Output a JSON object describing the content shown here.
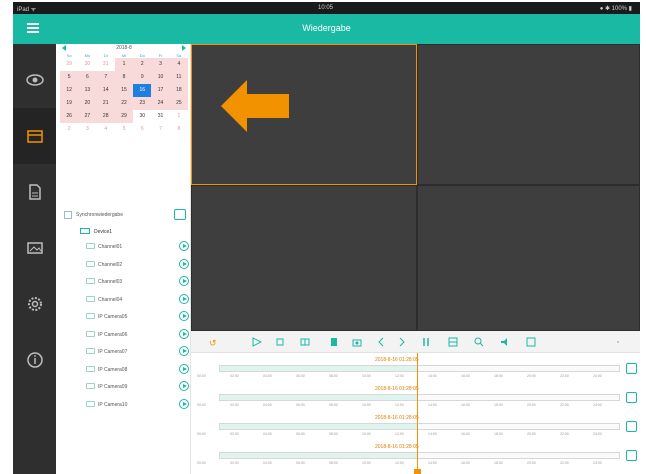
{
  "status_bar": {
    "left": "iPad ᯤ",
    "time": "10:05",
    "right": "● ✱ 100% ▮"
  },
  "header": {
    "title": "Wiedergabe"
  },
  "nav": [
    {
      "name": "live-view",
      "icon": "eye-icon",
      "active": false
    },
    {
      "name": "playback",
      "icon": "playback-icon",
      "active": true
    },
    {
      "name": "files",
      "icon": "file-icon",
      "active": false
    },
    {
      "name": "images",
      "icon": "image-icon",
      "active": false
    },
    {
      "name": "settings",
      "icon": "gear-icon",
      "active": false
    },
    {
      "name": "info",
      "icon": "info-icon",
      "active": false
    }
  ],
  "calendar": {
    "month_label": "2018-8",
    "weekdays": [
      "So",
      "Mo",
      "Di",
      "Mi",
      "Do",
      "Fr",
      "Sa"
    ],
    "days": [
      {
        "d": "29",
        "s": "other"
      },
      {
        "d": "30",
        "s": "other"
      },
      {
        "d": "31",
        "s": "other"
      },
      {
        "d": "1",
        "s": "rec"
      },
      {
        "d": "2",
        "s": "rec"
      },
      {
        "d": "3",
        "s": "rec"
      },
      {
        "d": "4",
        "s": "rec"
      },
      {
        "d": "5",
        "s": "rec"
      },
      {
        "d": "6",
        "s": "rec"
      },
      {
        "d": "7",
        "s": "rec"
      },
      {
        "d": "8",
        "s": "rec"
      },
      {
        "d": "9",
        "s": "rec"
      },
      {
        "d": "10",
        "s": "rec"
      },
      {
        "d": "11",
        "s": "rec"
      },
      {
        "d": "12",
        "s": "rec"
      },
      {
        "d": "13",
        "s": "rec"
      },
      {
        "d": "14",
        "s": "rec"
      },
      {
        "d": "15",
        "s": "rec"
      },
      {
        "d": "16",
        "s": "sel"
      },
      {
        "d": "17",
        "s": "rec"
      },
      {
        "d": "18",
        "s": "rec"
      },
      {
        "d": "19",
        "s": "rec"
      },
      {
        "d": "20",
        "s": "rec"
      },
      {
        "d": "21",
        "s": "rec"
      },
      {
        "d": "22",
        "s": "rec"
      },
      {
        "d": "23",
        "s": "rec"
      },
      {
        "d": "24",
        "s": "rec"
      },
      {
        "d": "25",
        "s": "rec"
      },
      {
        "d": "26",
        "s": "rec"
      },
      {
        "d": "27",
        "s": "rec"
      },
      {
        "d": "28",
        "s": "rec"
      },
      {
        "d": "29",
        "s": "rec"
      },
      {
        "d": "30",
        "s": ""
      },
      {
        "d": "31",
        "s": ""
      },
      {
        "d": "1",
        "s": "other"
      },
      {
        "d": "2",
        "s": "other"
      },
      {
        "d": "3",
        "s": "other"
      },
      {
        "d": "4",
        "s": "other"
      },
      {
        "d": "5",
        "s": "other"
      },
      {
        "d": "6",
        "s": "other"
      },
      {
        "d": "7",
        "s": "other"
      },
      {
        "d": "8",
        "s": "other"
      }
    ]
  },
  "sync": {
    "label": "Synchronwiedergabe"
  },
  "device": {
    "label": "Device1"
  },
  "channels": [
    "Channel01",
    "Channel02",
    "Channel03",
    "Channel04",
    "IP Camera05",
    "IP Camera06",
    "IP Camera07",
    "IP Camera08",
    "IP Camera09",
    "IP Camera10"
  ],
  "toolbar": [
    "rewind-icon",
    "play-icon",
    "stop-icon",
    "frame-icon",
    "clip-icon",
    "snapshot-icon",
    "slow-icon",
    "fast-icon",
    "pause-icon",
    "record-icon",
    "zoom-icon",
    "audio-icon",
    "fullscreen-icon",
    "more-icon"
  ],
  "timeline": {
    "tracks": [
      {
        "date": "2018-8-16 01:28:05"
      },
      {
        "date": "2018-8-16 01:28:05"
      },
      {
        "date": "2018-8-16 01:28:05"
      },
      {
        "date": "2018-8-16 01:28:05"
      }
    ],
    "ticks": [
      "00:00",
      "02:00",
      "04:00",
      "06:00",
      "08:00",
      "10:00",
      "12:00",
      "14:00",
      "16:00",
      "18:00",
      "20:00",
      "22:00",
      "24:00"
    ]
  },
  "colors": {
    "accent": "#1ab9a3",
    "selection": "#f39200",
    "video_bg": "#3e3e3e",
    "rail": "#2f2f2f"
  }
}
